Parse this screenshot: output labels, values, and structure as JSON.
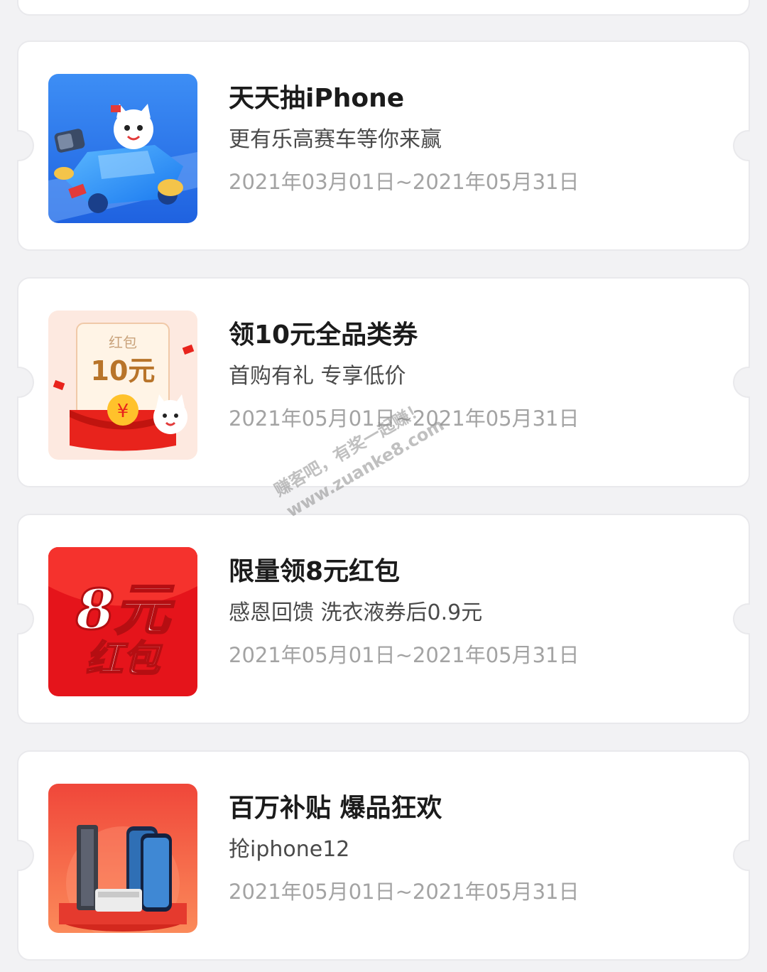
{
  "activities": [
    {
      "title": "天天抽iPhone",
      "subtitle": "更有乐高赛车等你来赢",
      "period": "2021年03月01日~2021年05月31日",
      "image": "cat-race-car-illustration"
    },
    {
      "title": "领10元全品类券",
      "subtitle": "首购有礼 专享低价",
      "period": "2021年05月01日~2021年05月31日",
      "image": "red-envelope-10-yuan",
      "image_text": {
        "label": "红包",
        "amount": "10元"
      }
    },
    {
      "title": "限量领8元红包",
      "subtitle": "感恩回馈 洗衣液券后0.9元",
      "period": "2021年05月01日~2021年05月31日",
      "image": "red-envelope-8-yuan",
      "image_text": {
        "amount": "8元",
        "label": "红包"
      }
    },
    {
      "title": "百万补贴 爆品狂欢",
      "subtitle": "抢iphone12",
      "period": "2021年05月01日~2021年05月31日",
      "image": "phones-on-red-stage"
    }
  ],
  "watermark": {
    "line1": "赚客吧，有奖一起赚！",
    "line2": "www.zuanke8.com"
  }
}
